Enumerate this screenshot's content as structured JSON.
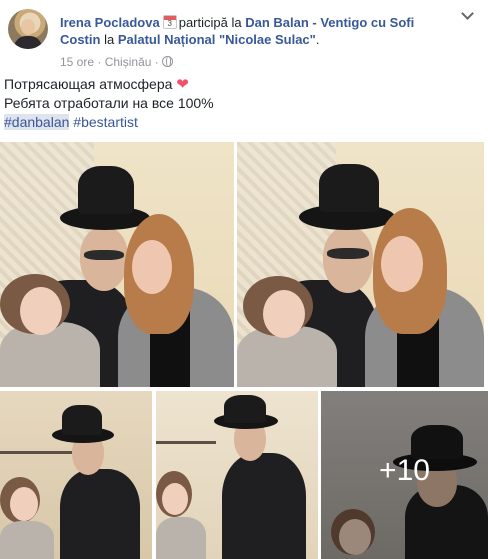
{
  "post": {
    "author": "Irena Pocladova",
    "calendar_day": "3",
    "participation_text": "participă la",
    "event_name": "Dan Balan - Ventigo cu Sofi Costin",
    "venue_prefix": "la",
    "venue_name": "Palatul Național \"Nicolae Sulac\"",
    "time": "15 ore",
    "separator": "·",
    "location": "Chișinău",
    "line1": "Потрясающая атмосфера",
    "line2": "Ребята отработали на все 100%",
    "hashtags": [
      "#danbalan",
      "#bestartist"
    ]
  },
  "gallery": {
    "more_count": "+10"
  }
}
